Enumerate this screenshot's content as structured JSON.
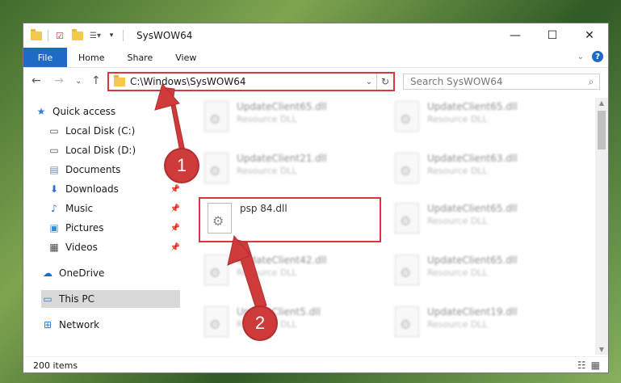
{
  "window": {
    "title": "SysWOW64",
    "minimize": "—",
    "maximize": "☐",
    "close": "✕"
  },
  "ribbon": {
    "tabs": [
      "File",
      "Home",
      "Share",
      "View"
    ],
    "help": "?"
  },
  "address": {
    "path": "C:\\Windows\\SysWOW64",
    "search_placeholder": "Search SysWOW64"
  },
  "nav": {
    "items": [
      {
        "label": "Quick access",
        "icon": "star-icon",
        "pinned": false
      },
      {
        "label": "Local Disk (C:)",
        "icon": "drive-icon",
        "pinned": false
      },
      {
        "label": "Local Disk (D:)",
        "icon": "drive-icon",
        "pinned": false
      },
      {
        "label": "Documents",
        "icon": "document-icon",
        "pinned": true
      },
      {
        "label": "Downloads",
        "icon": "download-icon",
        "pinned": true
      },
      {
        "label": "Music",
        "icon": "music-icon",
        "pinned": true
      },
      {
        "label": "Pictures",
        "icon": "picture-icon",
        "pinned": true
      },
      {
        "label": "Videos",
        "icon": "video-icon",
        "pinned": true
      },
      {
        "label": "OneDrive",
        "icon": "cloud-icon",
        "pinned": false
      },
      {
        "label": "This PC",
        "icon": "computer-icon",
        "pinned": false
      },
      {
        "label": "Network",
        "icon": "network-icon",
        "pinned": false
      }
    ]
  },
  "files": [
    {
      "name": "UpdateClient65.dll",
      "type": "Resource DLL"
    },
    {
      "name": "UpdateClient65.dll",
      "type": "Resource DLL"
    },
    {
      "name": "UpdateClient21.dll",
      "type": "Resource DLL"
    },
    {
      "name": "UpdateClient63.dll",
      "type": "Resource DLL"
    },
    {
      "name": "psp 84.dll",
      "type": ""
    },
    {
      "name": "UpdateClient65.dll",
      "type": "Resource DLL"
    },
    {
      "name": "UpdateClient42.dll",
      "type": "Resource DLL"
    },
    {
      "name": "UpdateClient65.dll",
      "type": "Resource DLL"
    },
    {
      "name": "UpdateClient5.dll",
      "type": "Resource DLL"
    },
    {
      "name": "UpdateClient19.dll",
      "type": "Resource DLL"
    }
  ],
  "status": {
    "count": "200 items"
  },
  "badges": [
    "1",
    "2"
  ],
  "colors": {
    "accent": "#1f6ac5",
    "highlight": "#d9363e",
    "badge": "#cf3a3a"
  }
}
